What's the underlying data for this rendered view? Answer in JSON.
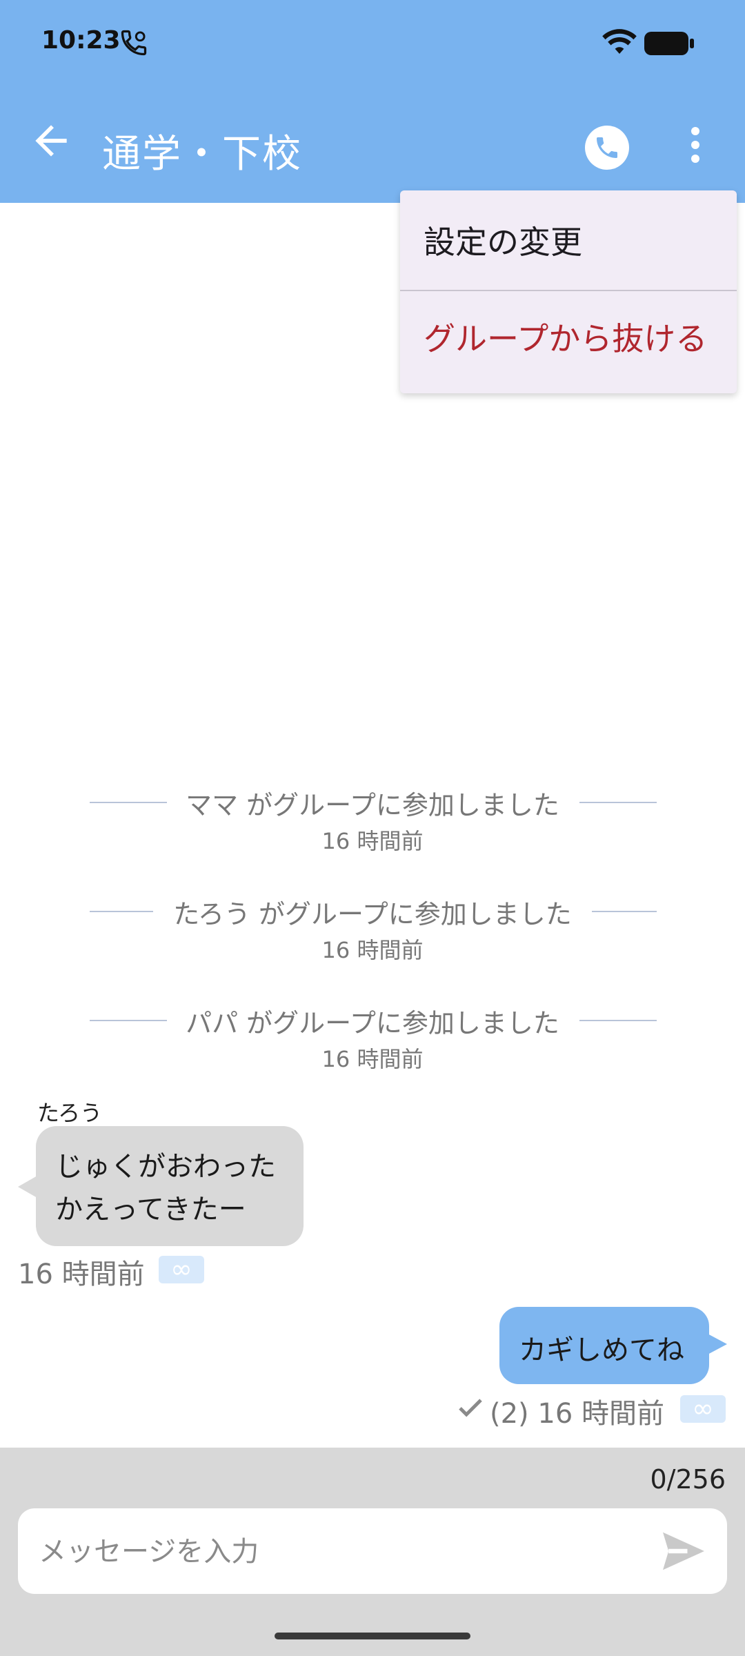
{
  "status_bar": {
    "time": "10:23"
  },
  "app_bar": {
    "title": "通学・下校"
  },
  "menu": {
    "items": [
      {
        "label": "設定の変更"
      },
      {
        "label": "グループから抜ける"
      }
    ]
  },
  "system_messages": [
    {
      "text": "ママ がグループに参加しました",
      "time": "16 時間前"
    },
    {
      "text": "たろう がグループに参加しました",
      "time": "16 時間前"
    },
    {
      "text": "パパ がグループに参加しました",
      "time": "16 時間前"
    }
  ],
  "messages": [
    {
      "sender": "たろう",
      "lines": [
        "じゅくがおわった",
        "かえってきたー"
      ],
      "time": "16 時間前",
      "badge": "∞"
    },
    {
      "text": "カギしめてね",
      "read": "(2) 16 時間前",
      "badge": "∞"
    }
  ],
  "composer": {
    "count": "0/256",
    "placeholder": "メッセージを入力"
  },
  "colors": {
    "header": "#79b3ef",
    "incoming_bubble": "#d9d9d9",
    "outgoing_bubble": "#7eb6f0",
    "danger": "#b0262e"
  }
}
